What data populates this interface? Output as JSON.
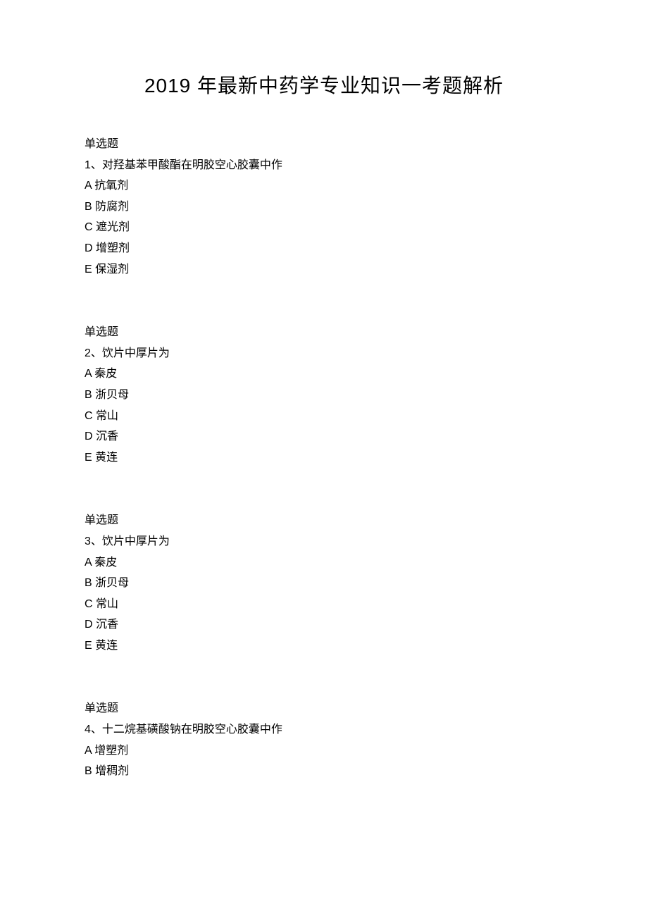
{
  "title": "2019 年最新中药学专业知识一考题解析",
  "questions": [
    {
      "type": "单选题",
      "number": "1、",
      "stem": "对羟基苯甲酸酯在明胶空心胶囊中作",
      "options": [
        "A 抗氧剂",
        "B 防腐剂",
        "C 遮光剂",
        "D 增塑剂",
        "E 保湿剂"
      ]
    },
    {
      "type": "单选题",
      "number": "2、",
      "stem": "饮片中厚片为",
      "options": [
        "A 秦皮",
        "B 浙贝母",
        "C 常山",
        "D 沉香",
        "E 黄连"
      ]
    },
    {
      "type": "单选题",
      "number": "3、",
      "stem": "饮片中厚片为",
      "options": [
        "A 秦皮",
        "B 浙贝母",
        "C 常山",
        "D 沉香",
        "E 黄连"
      ]
    },
    {
      "type": "单选题",
      "number": "4、",
      "stem": "十二烷基磺酸钠在明胶空心胶囊中作",
      "options": [
        "A 增塑剂",
        "B 增稠剂"
      ]
    }
  ]
}
